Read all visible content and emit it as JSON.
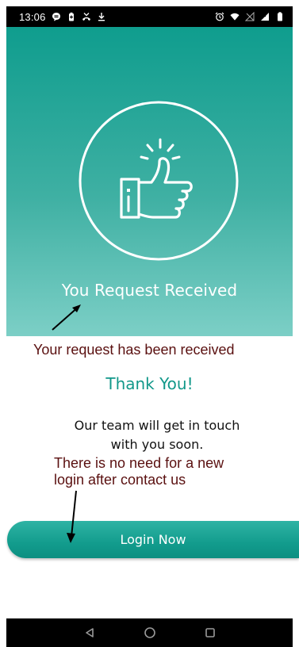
{
  "status_bar": {
    "time": "13:06",
    "left_icons": [
      "chat-bubble-icon",
      "battery-saver-icon",
      "missed-call-icon",
      "download-icon"
    ],
    "right_icons": [
      "alarm-icon",
      "wifi-icon",
      "signal-off-icon",
      "signal-icon",
      "battery-icon"
    ]
  },
  "hero": {
    "icon": "thumbs-up-icon",
    "title": "You Request Received",
    "background_top": "#0f9d8e",
    "background_bottom": "#7ccfc6"
  },
  "annotations": {
    "request_received_note": "Your request has been received",
    "login_note_line1": "There is no need for a new",
    "login_note_line2": "login after contact us",
    "color": "#5a1010"
  },
  "content": {
    "thank_you": "Thank You!",
    "message_line1": "Our team will get in touch",
    "message_line2": "with you soon."
  },
  "login_button": {
    "label": "Login Now",
    "color": "#129c8d"
  },
  "nav_bar": {
    "buttons": [
      "back-icon",
      "home-icon",
      "recents-icon"
    ]
  }
}
